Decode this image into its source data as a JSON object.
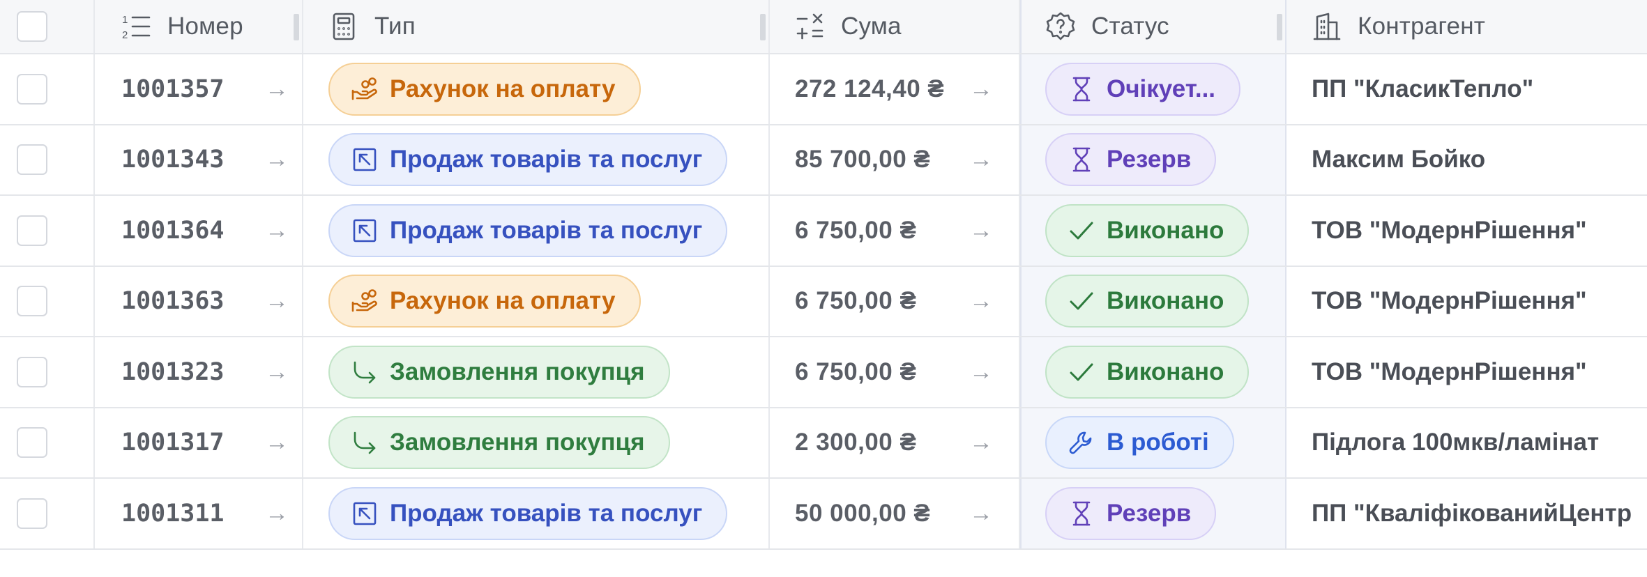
{
  "columns": {
    "number": "Номер",
    "type": "Тип",
    "sum": "Сума",
    "status": "Статус",
    "counterparty": "Контрагент"
  },
  "icons": {
    "number": "numbered-list-icon",
    "type": "calculator-icon",
    "sum": "math-operations-icon",
    "status": "help-badge-icon",
    "counterparty": "building-icon"
  },
  "colors": {
    "invoice": "#c7670b",
    "sale": "#3651bf",
    "order": "#2f7d3f",
    "pending": "#6040b8",
    "done": "#2c7a3c",
    "in_progress": "#2c5bd2"
  },
  "rows": [
    {
      "number": "1001357",
      "type": "Рахунок на оплату",
      "type_icon": "hand-coins-icon",
      "sum": "272 124,40 ₴",
      "status": "Очікует...",
      "status_icon": "hourglass-icon",
      "counterparty": "ПП \"КласикТепло\""
    },
    {
      "number": "1001343",
      "type": "Продаж товарів та послуг",
      "type_icon": "arrow-up-left-box-icon",
      "sum": "85 700,00 ₴",
      "status": "Резерв",
      "status_icon": "hourglass-icon",
      "counterparty": "Максим Бойко"
    },
    {
      "number": "1001364",
      "type": "Продаж товарів та послуг",
      "type_icon": "arrow-up-left-box-icon",
      "sum": "6 750,00 ₴",
      "status": "Виконано",
      "status_icon": "check-icon",
      "counterparty": "ТОВ \"МодернРішення\""
    },
    {
      "number": "1001363",
      "type": "Рахунок на оплату",
      "type_icon": "hand-coins-icon",
      "sum": "6 750,00 ₴",
      "status": "Виконано",
      "status_icon": "check-icon",
      "counterparty": "ТОВ \"МодернРішення\""
    },
    {
      "number": "1001323",
      "type": "Замовлення покупця",
      "type_icon": "corner-down-right-icon",
      "sum": "6 750,00 ₴",
      "status": "Виконано",
      "status_icon": "check-icon",
      "counterparty": "ТОВ \"МодернРішення\""
    },
    {
      "number": "1001317",
      "type": "Замовлення покупця",
      "type_icon": "corner-down-right-icon",
      "sum": "2 300,00 ₴",
      "status": "В роботі",
      "status_icon": "wrench-icon",
      "counterparty": "Підлога 100мкв/ламінат"
    },
    {
      "number": "1001311",
      "type": "Продаж товарів та послуг",
      "type_icon": "arrow-up-left-box-icon",
      "sum": "50 000,00 ₴",
      "status": "Резерв",
      "status_icon": "hourglass-icon",
      "counterparty": "ПП \"КваліфікованийЦентр"
    }
  ]
}
